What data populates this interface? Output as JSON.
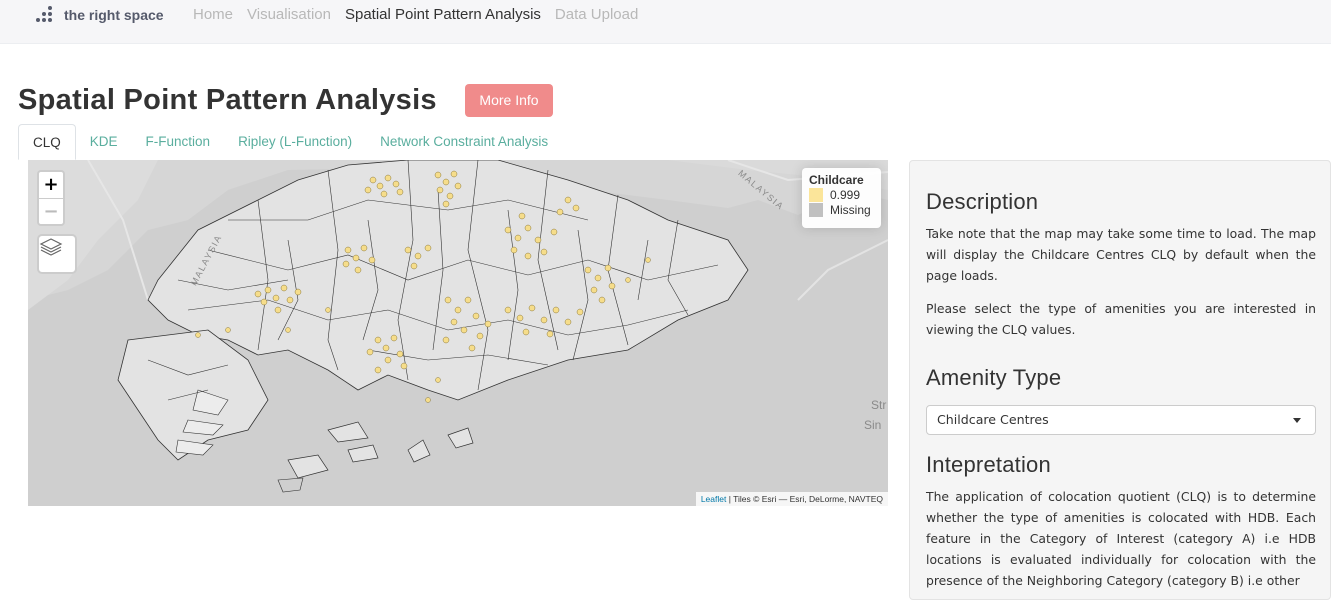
{
  "navbar": {
    "brand": "the right space",
    "links": [
      {
        "label": "Home",
        "active": false
      },
      {
        "label": "Visualisation",
        "active": false
      },
      {
        "label": "Spatial Point Pattern Analysis",
        "active": true
      },
      {
        "label": "Data Upload",
        "active": false
      }
    ]
  },
  "page": {
    "title": "Spatial Point Pattern Analysis",
    "more_info": "More Info",
    "accent_color": "#f08b8b"
  },
  "tabs": [
    "CLQ",
    "KDE",
    "F-Function",
    "Ripley (L-Function)",
    "Network Constraint Analysis"
  ],
  "map": {
    "zoom_in": "+",
    "zoom_out": "−",
    "legend": {
      "title": "Childcare",
      "items": [
        {
          "label": "0.999",
          "color": "#fbe59a"
        },
        {
          "label": "Missing",
          "color": "#c0c0c0"
        }
      ]
    },
    "attribution_link": "Leaflet",
    "attribution_text": "| Tiles © Esri — Esri, DeLorme, NAVTEQ",
    "labels": {
      "malaysia_west": "MALAYSIA",
      "malaysia_east": "MALAYSIA",
      "strait": "Str",
      "singapore": "Sin"
    }
  },
  "sidebar": {
    "description_heading": "Description",
    "description_p1": "Take note that the map may take some time to load. The map will display the Childcare Centres CLQ by default when the page loads.",
    "description_p2": "Please select the type of amenities you are interested in viewing the CLQ values.",
    "amenity_heading": "Amenity Type",
    "amenity_selected": "Childcare Centres",
    "interpretation_heading": "Intepretation",
    "interpretation_text": "The application of colocation quotient (CLQ) is to determine whether the type of amenities is colocated with HDB. Each feature in the Category of Interest (category A) i.e HDB locations is evaluated individually for colocation with the presence of the Neighboring Category (category B) i.e other"
  }
}
